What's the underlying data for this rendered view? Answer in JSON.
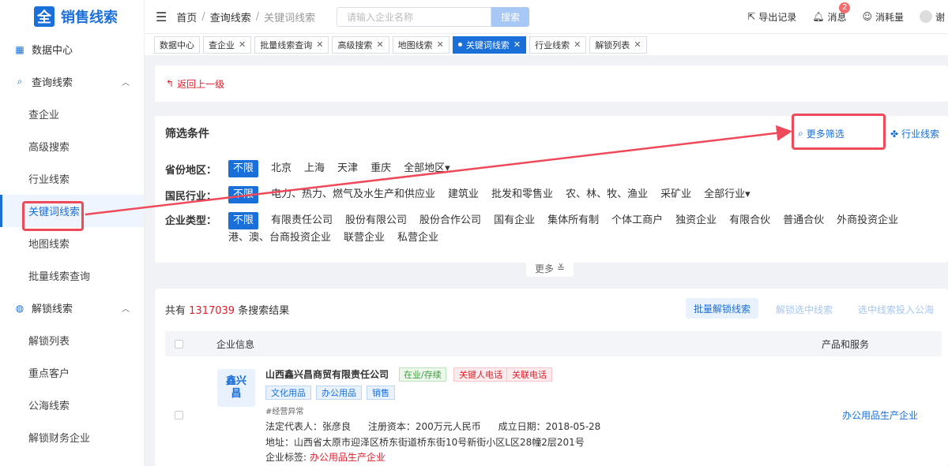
{
  "app": {
    "logo_glyph": "全",
    "logo_text": "销售线索"
  },
  "sidebar": {
    "data_center": "数据中心",
    "query_group": "查询线索",
    "query_items": [
      "查企业",
      "高级搜索",
      "行业线索",
      "关键词线索",
      "地图线索",
      "批量线索查询"
    ],
    "unlock_group": "解锁线索",
    "unlock_items": [
      "解锁列表",
      "重点客户",
      "公海线索",
      "解锁财务企业"
    ]
  },
  "topbar": {
    "breadcrumb": [
      "首页",
      "查询线索",
      "关键词线索"
    ],
    "search_placeholder": "请输入企业名称",
    "search_button": "搜索",
    "export": "导出记录",
    "messages": "消息",
    "message_count": "2",
    "consumption": "消耗量",
    "user_initial": "谢"
  },
  "tabs": [
    {
      "label": "数据中心",
      "closable": false
    },
    {
      "label": "查企业",
      "closable": true
    },
    {
      "label": "批量线索查询",
      "closable": true
    },
    {
      "label": "高级搜索",
      "closable": true
    },
    {
      "label": "地图线索",
      "closable": true
    },
    {
      "label": "关键词线索",
      "closable": true,
      "active": true
    },
    {
      "label": "行业线索",
      "closable": true
    },
    {
      "label": "解锁列表",
      "closable": true
    }
  ],
  "back": {
    "label": "返回上一级"
  },
  "filter": {
    "title": "筛选条件",
    "more_filter": "更多筛选",
    "industry_link": "行业线索",
    "more_toggle": "更多",
    "province": {
      "label": "省份地区：",
      "options": [
        "不限",
        "北京",
        "上海",
        "天津",
        "重庆",
        "全部地区▾"
      ]
    },
    "industry": {
      "label": "国民行业：",
      "options": [
        "不限",
        "电力、热力、燃气及水生产和供应业",
        "建筑业",
        "批发和零售业",
        "农、林、牧、渔业",
        "采矿业",
        "全部行业▾"
      ]
    },
    "company_type": {
      "label": "企业类型：",
      "options": [
        "不限",
        "有限责任公司",
        "股份有限公司",
        "股份合作公司",
        "国有企业",
        "集体所有制",
        "个体工商户",
        "独资企业",
        "有限合伙",
        "普通合伙",
        "外商投资企业",
        "港、澳、台商投资企业",
        "联营企业",
        "私营企业"
      ]
    }
  },
  "results": {
    "prefix": "共有",
    "count": "1317039",
    "suffix": "条搜索结果",
    "batch_unlock": "批量解锁线索",
    "unlock_selected": "解锁选中线索",
    "to_public_pool": "选中线索投入公海",
    "col_info": "企业信息",
    "col_products": "产品和服务",
    "rows": [
      {
        "logo": "鑫兴\n昌",
        "name": "山西鑫兴昌商贸有限责任公司",
        "status": "在业/存续",
        "tag_key_phone": "关键人电话",
        "tag_related_phone": "关联电话",
        "tags": [
          "文化用品",
          "办公用品",
          "销售"
        ],
        "abnormal": "#经营异常",
        "legal_rep": "法定代表人：张彦良",
        "capital": "注册资本：200万元人民币",
        "founded": "成立日期：2018-05-28",
        "address": "地址：山西省太原市迎泽区桥东街道桥东街10号新街小区L区28幢2层201号",
        "label_prefix": "企业标签:",
        "label_value": "办公用品生产企业",
        "product": "办公用品生产企业"
      }
    ]
  },
  "colors": {
    "accent": "#1a6fd8",
    "highlight": "#ee4a5a",
    "danger": "#e0202e"
  }
}
